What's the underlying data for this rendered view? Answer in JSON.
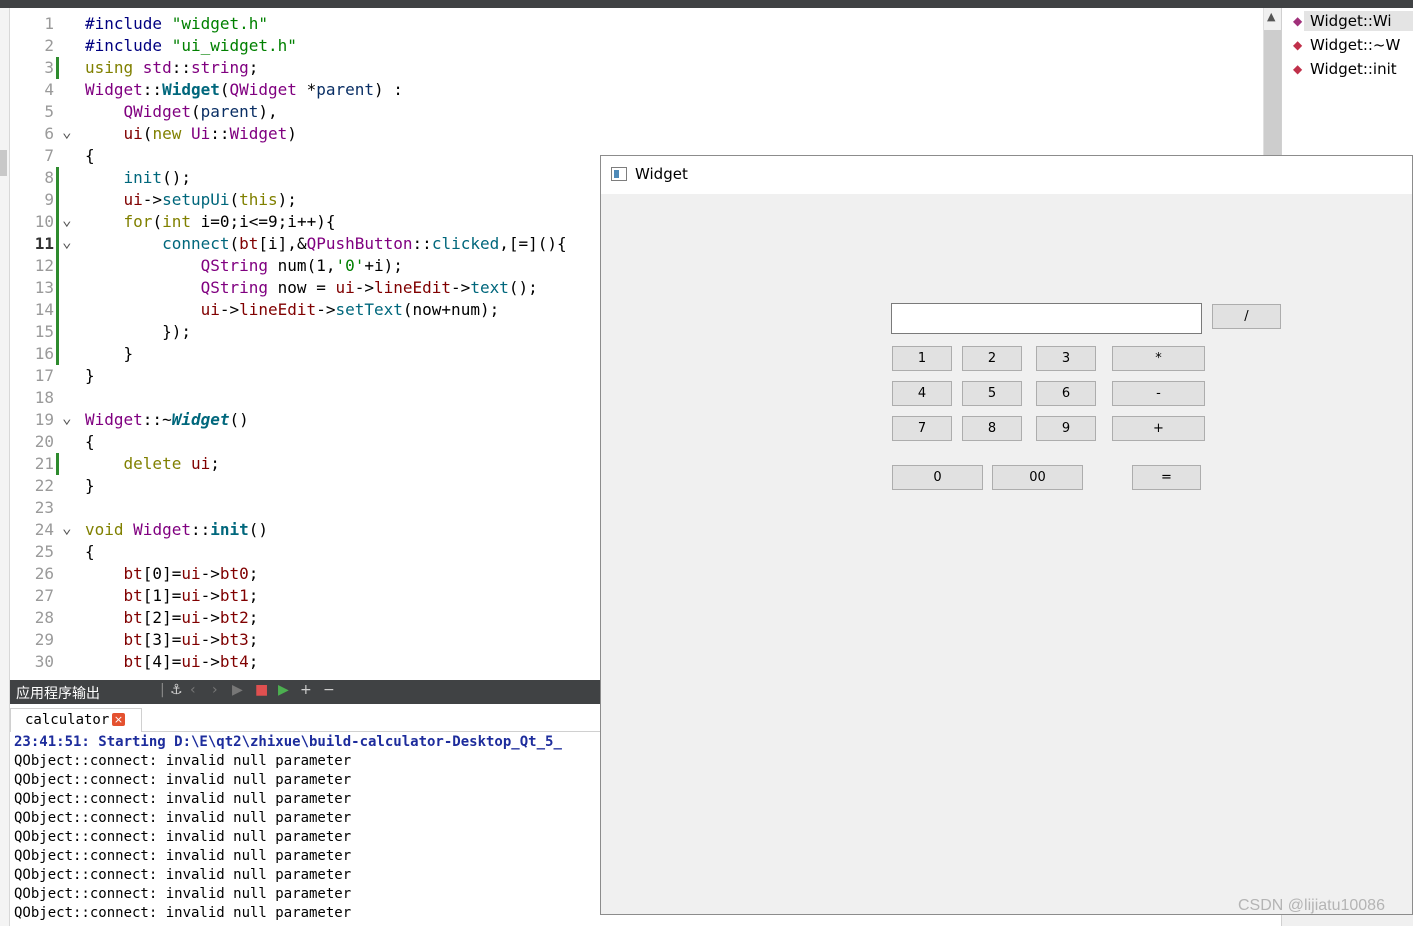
{
  "editor": {
    "line_numbers": [
      "1",
      "2",
      "3",
      "4",
      "5",
      "6",
      "7",
      "8",
      "9",
      "10",
      "11",
      "12",
      "13",
      "14",
      "15",
      "16",
      "17",
      "18",
      "19",
      "20",
      "21",
      "22",
      "23",
      "24",
      "25",
      "26",
      "27",
      "28",
      "29",
      "30"
    ],
    "current_line": "11",
    "lines": [
      [
        {
          "t": "#include ",
          "c": "pp"
        },
        {
          "t": "\"widget.h\"",
          "c": "str"
        }
      ],
      [
        {
          "t": "#include ",
          "c": "pp"
        },
        {
          "t": "\"ui_widget.h\"",
          "c": "str"
        }
      ],
      [
        {
          "t": "using ",
          "c": "kw"
        },
        {
          "t": "std",
          "c": "ty"
        },
        {
          "t": "::",
          "c": ""
        },
        {
          "t": "string",
          "c": "ty"
        },
        {
          "t": ";",
          "c": ""
        }
      ],
      [
        {
          "t": "Widget",
          "c": "ty"
        },
        {
          "t": "::",
          "c": ""
        },
        {
          "t": "Widget",
          "c": "fnb"
        },
        {
          "t": "(",
          "c": ""
        },
        {
          "t": "QWidget",
          "c": "ty"
        },
        {
          "t": " *",
          "c": ""
        },
        {
          "t": "parent",
          "c": "par"
        },
        {
          "t": ") :",
          "c": ""
        }
      ],
      [
        {
          "t": "    ",
          "c": ""
        },
        {
          "t": "QWidget",
          "c": "ty"
        },
        {
          "t": "(",
          "c": ""
        },
        {
          "t": "parent",
          "c": "par"
        },
        {
          "t": "),",
          "c": ""
        }
      ],
      [
        {
          "t": "    ",
          "c": ""
        },
        {
          "t": "ui",
          "c": "mem"
        },
        {
          "t": "(",
          "c": ""
        },
        {
          "t": "new ",
          "c": "kw"
        },
        {
          "t": "Ui",
          "c": "ty"
        },
        {
          "t": "::",
          "c": ""
        },
        {
          "t": "Widget",
          "c": "ty"
        },
        {
          "t": ")",
          "c": ""
        }
      ],
      [
        {
          "t": "{",
          "c": ""
        }
      ],
      [
        {
          "t": "    ",
          "c": ""
        },
        {
          "t": "init",
          "c": "fc"
        },
        {
          "t": "();",
          "c": ""
        }
      ],
      [
        {
          "t": "    ",
          "c": ""
        },
        {
          "t": "ui",
          "c": "mem"
        },
        {
          "t": "->",
          "c": ""
        },
        {
          "t": "setupUi",
          "c": "fc"
        },
        {
          "t": "(",
          "c": ""
        },
        {
          "t": "this",
          "c": "kw"
        },
        {
          "t": ");",
          "c": ""
        }
      ],
      [
        {
          "t": "    ",
          "c": ""
        },
        {
          "t": "for",
          "c": "kw"
        },
        {
          "t": "(",
          "c": ""
        },
        {
          "t": "int ",
          "c": "kw"
        },
        {
          "t": "i=0;i<=9;i++){",
          "c": ""
        }
      ],
      [
        {
          "t": "        ",
          "c": ""
        },
        {
          "t": "connect",
          "c": "fc"
        },
        {
          "t": "(",
          "c": ""
        },
        {
          "t": "bt",
          "c": "mem"
        },
        {
          "t": "[i],&",
          "c": ""
        },
        {
          "t": "QPushButton",
          "c": "ty"
        },
        {
          "t": "::",
          "c": ""
        },
        {
          "t": "clicked",
          "c": "fc"
        },
        {
          "t": ",[=](){",
          "c": ""
        }
      ],
      [
        {
          "t": "            ",
          "c": ""
        },
        {
          "t": "QString ",
          "c": "ty"
        },
        {
          "t": "num",
          "c": ""
        },
        {
          "t": "(1,",
          "c": ""
        },
        {
          "t": "'0'",
          "c": "str"
        },
        {
          "t": "+i);",
          "c": ""
        }
      ],
      [
        {
          "t": "            ",
          "c": ""
        },
        {
          "t": "QString ",
          "c": "ty"
        },
        {
          "t": "now = ",
          "c": ""
        },
        {
          "t": "ui",
          "c": "mem"
        },
        {
          "t": "->",
          "c": ""
        },
        {
          "t": "lineEdit",
          "c": "mem"
        },
        {
          "t": "->",
          "c": ""
        },
        {
          "t": "text",
          "c": "fc"
        },
        {
          "t": "();",
          "c": ""
        }
      ],
      [
        {
          "t": "            ",
          "c": ""
        },
        {
          "t": "ui",
          "c": "mem"
        },
        {
          "t": "->",
          "c": ""
        },
        {
          "t": "lineEdit",
          "c": "mem"
        },
        {
          "t": "->",
          "c": ""
        },
        {
          "t": "setText",
          "c": "fc"
        },
        {
          "t": "(now+num);",
          "c": ""
        }
      ],
      [
        {
          "t": "        });",
          "c": ""
        }
      ],
      [
        {
          "t": "    }",
          "c": ""
        }
      ],
      [
        {
          "t": "}",
          "c": ""
        }
      ],
      [],
      [
        {
          "t": "Widget",
          "c": "ty"
        },
        {
          "t": "::~",
          "c": ""
        },
        {
          "t": "Widget",
          "c": "fni"
        },
        {
          "t": "()",
          "c": ""
        }
      ],
      [
        {
          "t": "{",
          "c": ""
        }
      ],
      [
        {
          "t": "    ",
          "c": ""
        },
        {
          "t": "delete ",
          "c": "kw"
        },
        {
          "t": "ui",
          "c": "mem"
        },
        {
          "t": ";",
          "c": ""
        }
      ],
      [
        {
          "t": "}",
          "c": ""
        }
      ],
      [],
      [
        {
          "t": "void ",
          "c": "kw"
        },
        {
          "t": "Widget",
          "c": "ty"
        },
        {
          "t": "::",
          "c": ""
        },
        {
          "t": "init",
          "c": "fnb"
        },
        {
          "t": "()",
          "c": ""
        }
      ],
      [
        {
          "t": "{",
          "c": ""
        }
      ],
      [
        {
          "t": "    ",
          "c": ""
        },
        {
          "t": "bt",
          "c": "mem"
        },
        {
          "t": "[0]=",
          "c": ""
        },
        {
          "t": "ui",
          "c": "mem"
        },
        {
          "t": "->",
          "c": ""
        },
        {
          "t": "bt0",
          "c": "mem"
        },
        {
          "t": ";",
          "c": ""
        }
      ],
      [
        {
          "t": "    ",
          "c": ""
        },
        {
          "t": "bt",
          "c": "mem"
        },
        {
          "t": "[1]=",
          "c": ""
        },
        {
          "t": "ui",
          "c": "mem"
        },
        {
          "t": "->",
          "c": ""
        },
        {
          "t": "bt1",
          "c": "mem"
        },
        {
          "t": ";",
          "c": ""
        }
      ],
      [
        {
          "t": "    ",
          "c": ""
        },
        {
          "t": "bt",
          "c": "mem"
        },
        {
          "t": "[2]=",
          "c": ""
        },
        {
          "t": "ui",
          "c": "mem"
        },
        {
          "t": "->",
          "c": ""
        },
        {
          "t": "bt2",
          "c": "mem"
        },
        {
          "t": ";",
          "c": ""
        }
      ],
      [
        {
          "t": "    ",
          "c": ""
        },
        {
          "t": "bt",
          "c": "mem"
        },
        {
          "t": "[3]=",
          "c": ""
        },
        {
          "t": "ui",
          "c": "mem"
        },
        {
          "t": "->",
          "c": ""
        },
        {
          "t": "bt3",
          "c": "mem"
        },
        {
          "t": ";",
          "c": ""
        }
      ],
      [
        {
          "t": "    ",
          "c": ""
        },
        {
          "t": "bt",
          "c": "mem"
        },
        {
          "t": "[4]=",
          "c": ""
        },
        {
          "t": "ui",
          "c": "mem"
        },
        {
          "t": "->",
          "c": ""
        },
        {
          "t": "bt4",
          "c": "mem"
        },
        {
          "t": ";",
          "c": ""
        }
      ]
    ]
  },
  "outline": {
    "items": [
      "Widget::Wi",
      "Widget::~W",
      "Widget::init"
    ],
    "icons": [
      "diamond-icon",
      "diamond-icon",
      "locked-diamond-icon"
    ]
  },
  "output_pane": {
    "title": "应用程序输出",
    "tab_label": "calculator",
    "tab_close": "×",
    "start_line": "23:41:51: Starting D:\\E\\qt2\\zhixue\\build-calculator-Desktop_Qt_5_",
    "messages": [
      "QObject::connect: invalid null parameter",
      "QObject::connect: invalid null parameter",
      "QObject::connect: invalid null parameter",
      "QObject::connect: invalid null parameter",
      "QObject::connect: invalid null parameter",
      "QObject::connect: invalid null parameter",
      "QObject::connect: invalid null parameter",
      "QObject::connect: invalid null parameter",
      "QObject::connect: invalid null parameter"
    ]
  },
  "calculator_window": {
    "title": "Widget",
    "input_value": "",
    "buttons": {
      "divide": "/",
      "b1": "1",
      "b2": "2",
      "b3": "3",
      "multiply": "*",
      "b4": "4",
      "b5": "5",
      "b6": "6",
      "minus": "-",
      "b7": "7",
      "b8": "8",
      "b9": "9",
      "plus": "+",
      "b0": "0",
      "b00": "00",
      "equals": "="
    }
  },
  "watermark": "CSDN @lijiatu10086"
}
